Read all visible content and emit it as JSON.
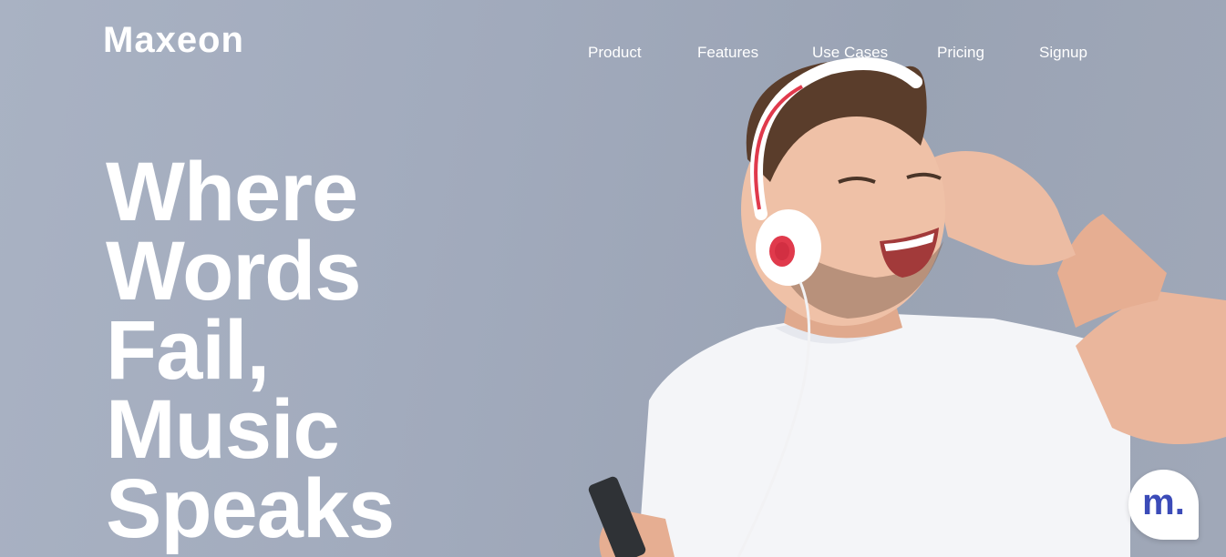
{
  "brand": {
    "name": "Maxeon"
  },
  "nav": {
    "items": [
      "Product",
      "Features",
      "Use Cases",
      "Pricing",
      "Signup"
    ]
  },
  "hero": {
    "headline_lines": [
      "Where",
      "Words",
      "Fail,",
      "Music",
      "Speaks"
    ],
    "image": "man-with-headphones-photo"
  },
  "chat_widget": {
    "label": "m.",
    "icon": "chat-bubble-icon"
  },
  "colors": {
    "background": "#a2abbd",
    "text": "#ffffff",
    "headphone_accent": "#e03a4c",
    "chat_accent": "#3b4bb8"
  }
}
